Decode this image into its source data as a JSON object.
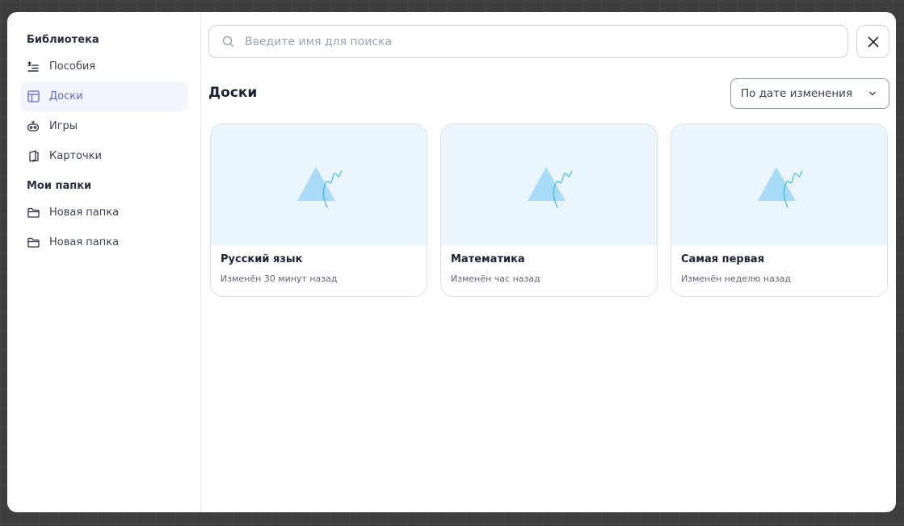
{
  "sidebar": {
    "library_title": "Библиотека",
    "library_items": [
      {
        "label": "Пособия",
        "icon": "list-icon"
      },
      {
        "label": "Доски",
        "icon": "board-layout-icon",
        "active": true
      },
      {
        "label": "Игры",
        "icon": "robot-icon"
      },
      {
        "label": "Карточки",
        "icon": "book-icon"
      }
    ],
    "folders_title": "Мои папки",
    "folders": [
      {
        "label": "Новая папка",
        "icon": "folder-icon"
      },
      {
        "label": "Новая папка",
        "icon": "folder-icon"
      }
    ]
  },
  "search": {
    "placeholder": "Введите имя для поиска",
    "value": ""
  },
  "main": {
    "title": "Доски",
    "sort_label": "По дате изменения"
  },
  "cards": [
    {
      "title": "Русский язык",
      "subtitle": "Изменён 30 минут назад"
    },
    {
      "title": "Математика",
      "subtitle": "Изменён час назад"
    },
    {
      "title": "Самая первая",
      "subtitle": "Изменён неделю назад"
    }
  ],
  "colors": {
    "accent": "#5b67c9",
    "active_bg": "#f3f5fc",
    "thumb_bg": "#eaf5fd",
    "triangle": "#a8dbf5",
    "squiggle": "#35b3df"
  }
}
